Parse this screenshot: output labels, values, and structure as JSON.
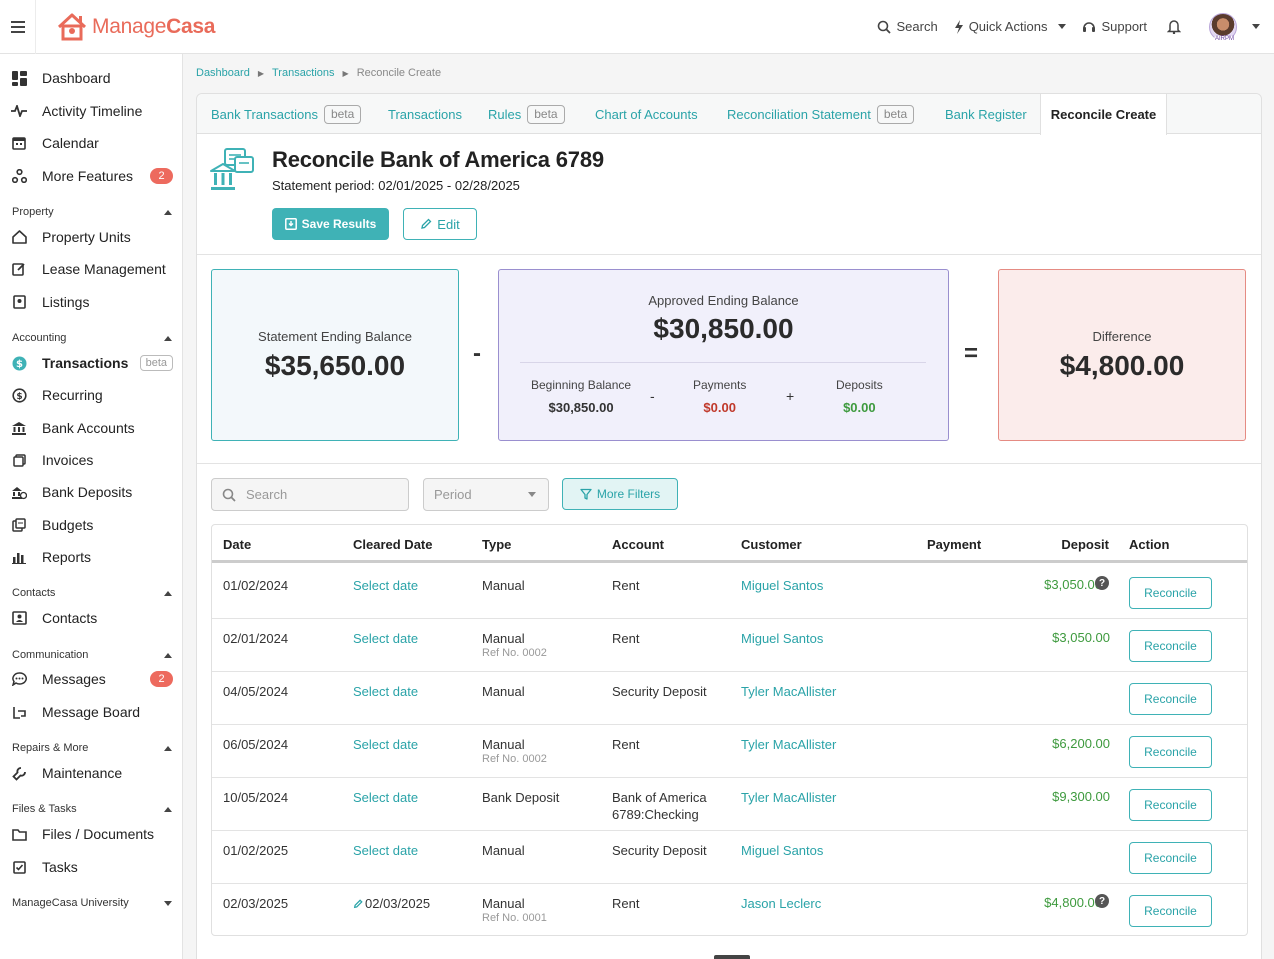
{
  "app": {
    "brand_prefix": "Manage",
    "brand_suffix": "Casa"
  },
  "topbar": {
    "search_label": "Search",
    "quick_actions_label": "Quick Actions",
    "support_label": "Support",
    "avatar_tag": "AIRPM"
  },
  "sidebar": {
    "items_top": [
      {
        "label": "Dashboard",
        "icon": "dashboard-icon"
      },
      {
        "label": "Activity Timeline",
        "icon": "activity-icon"
      },
      {
        "label": "Calendar",
        "icon": "calendar-icon"
      },
      {
        "label": "More Features",
        "icon": "features-icon",
        "badge": "2"
      }
    ],
    "sections": {
      "property": "Property",
      "accounting": "Accounting",
      "contacts": "Contacts",
      "communication": "Communication",
      "repairs": "Repairs & More",
      "files": "Files & Tasks",
      "university": "ManageCasa University"
    },
    "property_items": [
      "Property Units",
      "Lease Management",
      "Listings"
    ],
    "accounting_items": [
      "Transactions",
      "Recurring",
      "Bank Accounts",
      "Invoices",
      "Bank Deposits",
      "Budgets",
      "Reports"
    ],
    "transactions_badge": "beta",
    "contacts_items": [
      "Contacts"
    ],
    "communication_items": [
      "Messages",
      "Message Board"
    ],
    "messages_badge": "2",
    "repairs_items": [
      "Maintenance"
    ],
    "files_items": [
      "Files / Documents",
      "Tasks"
    ]
  },
  "breadcrumb": {
    "items": [
      "Dashboard",
      "Transactions"
    ],
    "current": "Reconcile Create"
  },
  "tabs": [
    {
      "label": "Bank Transactions",
      "badge": "beta"
    },
    {
      "label": "Transactions"
    },
    {
      "label": "Rules",
      "badge": "beta"
    },
    {
      "label": "Chart of Accounts"
    },
    {
      "label": "Reconciliation Statement",
      "badge": "beta"
    },
    {
      "label": "Bank Register"
    },
    {
      "label": "Reconcile Create"
    }
  ],
  "header": {
    "title": "Reconcile Bank of America 6789",
    "period": "Statement period: 02/01/2025 - 02/28/2025",
    "save_label": "Save Results",
    "edit_label": "Edit"
  },
  "balances": {
    "statement_label": "Statement Ending Balance",
    "statement_amount": "$35,650.00",
    "minus": "-",
    "approved_label": "Approved Ending Balance",
    "approved_amount": "$30,850.00",
    "beginning_label": "Beginning Balance",
    "beginning_amount": "$30,850.00",
    "payments_label": "Payments",
    "payments_amount": "$0.00",
    "deposits_label": "Deposits",
    "deposits_amount": "$0.00",
    "sub_minus": "-",
    "sub_plus": "+",
    "equals": "=",
    "difference_label": "Difference",
    "difference_amount": "$4,800.00"
  },
  "filters": {
    "search_placeholder": "Search",
    "period_placeholder": "Period",
    "more_filters_label": "More Filters"
  },
  "table": {
    "headers": [
      "Date",
      "Cleared Date",
      "Type",
      "Account",
      "Customer",
      "Payment",
      "Deposit",
      "Action"
    ],
    "rows": [
      {
        "date": "01/02/2024",
        "cleared": "Select date",
        "type": "Manual",
        "ref": "",
        "account": "Rent",
        "account2": "",
        "customer": "Miguel Santos",
        "payment": "",
        "deposit": "$3,050.00",
        "help": true,
        "action": "Reconcile"
      },
      {
        "date": "02/01/2024",
        "cleared": "Select date",
        "type": "Manual",
        "ref": "Ref No. 0002",
        "account": "Rent",
        "account2": "",
        "customer": "Miguel Santos",
        "payment": "",
        "deposit": "$3,050.00",
        "help": false,
        "action": "Reconcile"
      },
      {
        "date": "04/05/2024",
        "cleared": "Select date",
        "type": "Manual",
        "ref": "",
        "account": "Security Deposit",
        "account2": "",
        "customer": "Tyler MacAllister",
        "payment": "",
        "deposit": "",
        "help": false,
        "action": "Reconcile"
      },
      {
        "date": "06/05/2024",
        "cleared": "Select date",
        "type": "Manual",
        "ref": "Ref No. 0002",
        "account": "Rent",
        "account2": "",
        "customer": "Tyler MacAllister",
        "payment": "",
        "deposit": "$6,200.00",
        "help": false,
        "action": "Reconcile"
      },
      {
        "date": "10/05/2024",
        "cleared": "Select date",
        "type": "Bank Deposit",
        "ref": "",
        "account": "Bank of America",
        "account2": "6789:Checking",
        "customer": "Tyler MacAllister",
        "payment": "",
        "deposit": "$9,300.00",
        "help": false,
        "action": "Reconcile"
      },
      {
        "date": "01/02/2025",
        "cleared": "Select date",
        "type": "Manual",
        "ref": "",
        "account": "Security Deposit",
        "account2": "",
        "customer": "Miguel Santos",
        "payment": "",
        "deposit": "",
        "help": false,
        "action": "Reconcile"
      },
      {
        "date": "02/03/2025",
        "cleared": "02/03/2025",
        "cleared_edited": true,
        "type": "Manual",
        "ref": "Ref No. 0001",
        "account": "Rent",
        "account2": "",
        "customer": "Jason Leclerc",
        "payment": "",
        "deposit": "$4,800.00",
        "help": true,
        "action": "Reconcile"
      }
    ]
  },
  "colors": {
    "accent": "#3fb2b6",
    "brand": "#e96b5a",
    "negative": "#c0392b",
    "positive": "#3e9a3e"
  }
}
